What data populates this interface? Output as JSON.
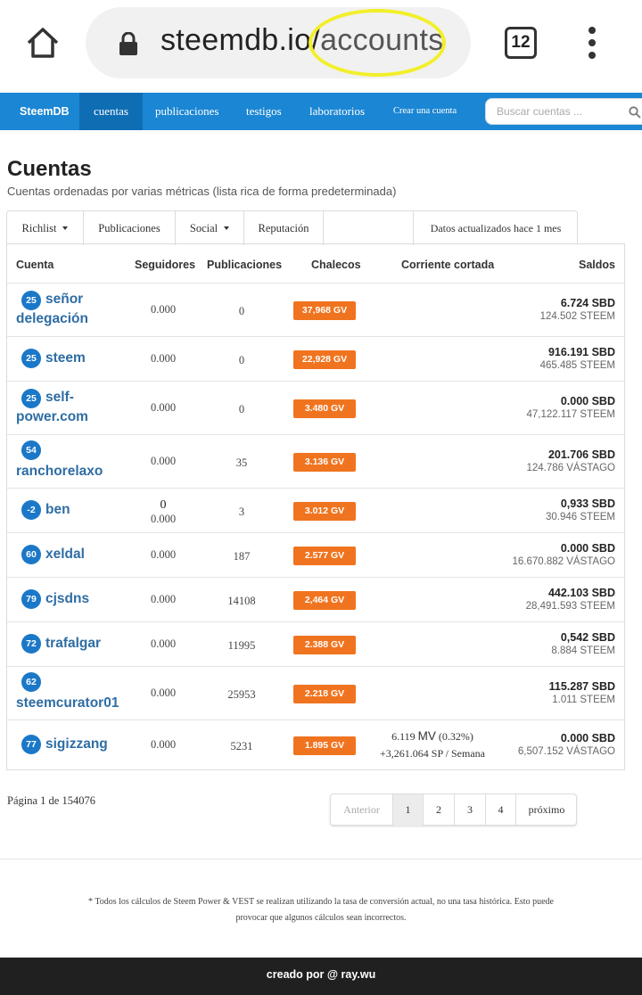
{
  "browser": {
    "url_domain": "steemdb.io/",
    "url_path": "accounts",
    "tab_count": "12"
  },
  "nav": {
    "brand": "SteemDB",
    "items": [
      "cuentas",
      "publicaciones",
      "testigos",
      "laboratorios",
      "Crear una cuenta"
    ],
    "active": "cuentas",
    "search_placeholder": "Buscar cuentas ..."
  },
  "page": {
    "title": "Cuentas",
    "subtitle": "Cuentas ordenadas por varias métricas (lista rica de forma predeterminada)"
  },
  "tabs": {
    "items": [
      "Richlist",
      "Publicaciones",
      "Social",
      "Reputación"
    ],
    "note": "Datos actualizados hace 1 mes"
  },
  "table": {
    "headers": [
      "Cuenta",
      "Seguidores",
      "Publicaciones",
      "Chalecos",
      "Corriente cortada",
      "Saldos"
    ],
    "rows": [
      {
        "rep": "25",
        "name_line1": "señor",
        "name_line2": "delegación",
        "followers_top": "",
        "followers": "0.000",
        "posts": "0",
        "vests": "37,968 GV",
        "power_line1": "",
        "power_mv": "",
        "power_pct": "",
        "power_line2": "",
        "sbd": "6.724 SBD",
        "steem": "124.502 STEEM"
      },
      {
        "rep": "25",
        "name_line1": "steem",
        "name_line2": "",
        "followers_top": "",
        "followers": "0.000",
        "posts": "0",
        "vests": "22,928 GV",
        "power_line1": "",
        "power_mv": "",
        "power_pct": "",
        "power_line2": "",
        "sbd": "916.191 SBD",
        "steem": "465.485 STEEM"
      },
      {
        "rep": "25",
        "name_line1": "self-",
        "name_line2": "power.com",
        "followers_top": "",
        "followers": "0.000",
        "posts": "0",
        "vests": "3.480 GV",
        "power_line1": "",
        "power_mv": "",
        "power_pct": "",
        "power_line2": "",
        "sbd": "0.000 SBD",
        "steem": "47,122.117 STEEM"
      },
      {
        "rep": "54",
        "name_line1": "",
        "name_line2": "ranchorelaxo",
        "followers_top": "",
        "followers": "0.000",
        "posts": "35",
        "vests": "3.136 GV",
        "power_line1": "",
        "power_mv": "",
        "power_pct": "",
        "power_line2": "",
        "sbd": "201.706 SBD",
        "steem": "124.786 VÁSTAGO"
      },
      {
        "rep": "-2",
        "name_line1": "ben",
        "name_line2": "",
        "followers_top": "0",
        "followers": "0.000",
        "posts": "3",
        "vests": "3.012 GV",
        "power_line1": "",
        "power_mv": "",
        "power_pct": "",
        "power_line2": "",
        "sbd": "0,933 SBD",
        "steem": "30.946 STEEM"
      },
      {
        "rep": "60",
        "name_line1": "xeldal",
        "name_line2": "",
        "followers_top": "",
        "followers": "0.000",
        "posts": "187",
        "vests": "2.577 GV",
        "power_line1": "",
        "power_mv": "",
        "power_pct": "",
        "power_line2": "",
        "sbd": "0.000 SBD",
        "steem": "16.670.882 VÁSTAGO"
      },
      {
        "rep": "79",
        "name_line1": "cjsdns",
        "name_line2": "",
        "followers_top": "",
        "followers": "0.000",
        "posts": "14108",
        "vests": "2,464 GV",
        "power_line1": "",
        "power_mv": "",
        "power_pct": "",
        "power_line2": "",
        "sbd": "442.103 SBD",
        "steem": "28,491.593 STEEM"
      },
      {
        "rep": "72",
        "name_line1": "trafalgar",
        "name_line2": "",
        "followers_top": "",
        "followers": "0.000",
        "posts": "11995",
        "vests": "2.388 GV",
        "power_line1": "",
        "power_mv": "",
        "power_pct": "",
        "power_line2": "",
        "sbd": "0,542 SBD",
        "steem": "8.884 STEEM"
      },
      {
        "rep": "62",
        "name_line1": "",
        "name_line2": "steemcurator01",
        "followers_top": "",
        "followers": "0.000",
        "posts": "25953",
        "vests": "2.218 GV",
        "power_line1": "",
        "power_mv": "",
        "power_pct": "",
        "power_line2": "",
        "sbd": "115.287 SBD",
        "steem": "1.011 STEEM"
      },
      {
        "rep": "77",
        "name_line1": "sigizzang",
        "name_line2": "",
        "followers_top": "",
        "followers": "0.000",
        "posts": "5231",
        "vests": "1.895 GV",
        "power_line1": "6.119",
        "power_mv": "MV",
        "power_pct": "(0.32%)",
        "power_line2": "+3,261.064 SP / Semana",
        "sbd": "0.000 SBD",
        "steem": "6,507.152 VÁSTAGO"
      }
    ]
  },
  "pagination": {
    "info_prefix": "Página",
    "current": "1",
    "info_middle": "de",
    "total": "154076",
    "prev": "Anterior",
    "pages": [
      "1",
      "2",
      "3",
      "4"
    ],
    "next": "próximo"
  },
  "footnote": {
    "line1": "* Todos los cálculos de Steem Power & VEST se realizan utilizando la tasa de conversión actual, no una tasa histórica. Esto puede",
    "line2": "provocar que algunos cálculos sean incorrectos."
  },
  "footer": {
    "text": "creado por @ ray.wu"
  },
  "colors": {
    "nav_blue": "#1b86d3",
    "badge_blue": "#1b78c8",
    "link_blue": "#2e6da4",
    "vests_orange": "#f0741f",
    "highlight_yellow": "#f2ef2a",
    "footer_dark": "#202020"
  }
}
